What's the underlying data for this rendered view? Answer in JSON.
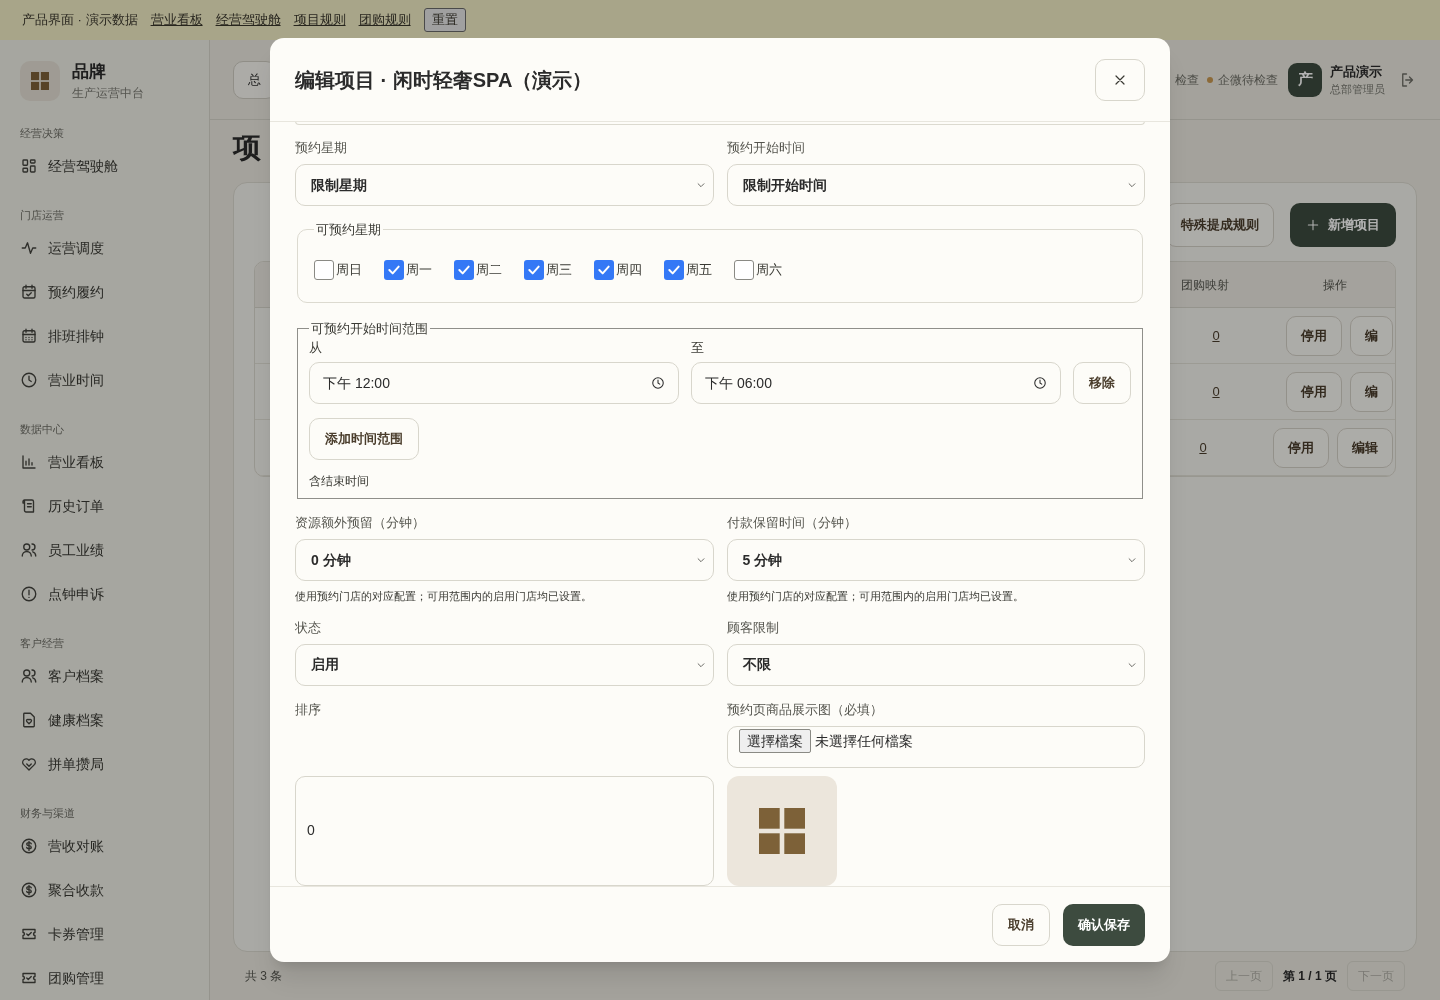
{
  "demo_bar": {
    "label": "产品界面 · 演示数据",
    "links": [
      "营业看板",
      "经营驾驶舱",
      "项目规则",
      "团购规则"
    ],
    "reset_button": "重置"
  },
  "sidebar": {
    "brand": {
      "name": "品牌",
      "subtitle": "生产运营中台"
    },
    "groups": [
      {
        "title": "经营决策",
        "items": [
          "经营驾驶舱"
        ]
      },
      {
        "title": "门店运营",
        "items": [
          "运营调度",
          "预约履约",
          "排班排钟",
          "营业时间"
        ]
      },
      {
        "title": "数据中心",
        "items": [
          "营业看板",
          "历史订单",
          "员工业绩",
          "点钟申诉"
        ]
      },
      {
        "title": "客户经营",
        "items": [
          "客户档案",
          "健康档案",
          "拼单攒局"
        ]
      },
      {
        "title": "财务与渠道",
        "items": [
          "营收对账",
          "聚合收款",
          "卡券管理",
          "团购管理"
        ]
      }
    ]
  },
  "header": {
    "branch_button": "总",
    "statuses": [
      {
        "label": "检查"
      },
      {
        "label": "企微待检查",
        "color": "#8c6a38"
      }
    ],
    "user": {
      "avatar": "产",
      "name": "产品演示",
      "role": "总部管理员"
    }
  },
  "page": {
    "title": "项",
    "commission_button": "特殊提成规则",
    "add_button": "新增项目",
    "table": {
      "columns": [
        "团购映射",
        "操作"
      ],
      "rows": [
        {
          "mapping": "0",
          "actions": [
            "停用",
            "编"
          ]
        },
        {
          "mapping": "0",
          "actions": [
            "停用",
            "编"
          ]
        },
        {
          "mapping": "0",
          "actions": [
            "停用",
            "编辑"
          ]
        }
      ]
    },
    "footer": {
      "total": "共 3 条",
      "prev": "上一页",
      "page": "第 1 / 1 页",
      "next": "下一页"
    }
  },
  "modal": {
    "title": "编辑项目 · 闲时轻奢SPA（演示）",
    "booking_weekday": {
      "label": "预约星期",
      "value": "限制星期"
    },
    "booking_start": {
      "label": "预约开始时间",
      "value": "限制开始时间"
    },
    "weekdays": {
      "legend": "可预约星期",
      "days": [
        {
          "label": "周日",
          "checked": false
        },
        {
          "label": "周一",
          "checked": true
        },
        {
          "label": "周二",
          "checked": true
        },
        {
          "label": "周三",
          "checked": true
        },
        {
          "label": "周四",
          "checked": true
        },
        {
          "label": "周五",
          "checked": true
        },
        {
          "label": "周六",
          "checked": false
        }
      ]
    },
    "time_ranges": {
      "legend": "可预约开始时间范围",
      "from_label": "从",
      "to_label": "至",
      "ranges": [
        {
          "from": "下午 12:00",
          "to": "下午 06:00",
          "remove": "移除"
        }
      ],
      "add_button": "添加时间范围",
      "hint": "含结束时间"
    },
    "resource_buffer": {
      "label": "资源额外预留（分钟）",
      "value": "0 分钟",
      "hint": "使用预约门店的对应配置；可用范围内的启用门店均已设置。"
    },
    "payment_hold": {
      "label": "付款保留时间（分钟）",
      "value": "5 分钟",
      "hint": "使用预约门店的对应配置；可用范围内的启用门店均已设置。"
    },
    "status": {
      "label": "状态",
      "value": "启用"
    },
    "customer_limit": {
      "label": "顾客限制",
      "value": "不限"
    },
    "sort": {
      "label": "排序",
      "value": "0"
    },
    "display_image": {
      "label": "预约页商品展示图（必填）",
      "choose_button": "選擇檔案",
      "no_file": "未選擇任何檔案"
    },
    "buttons": {
      "cancel": "取消",
      "save": "确认保存"
    }
  }
}
